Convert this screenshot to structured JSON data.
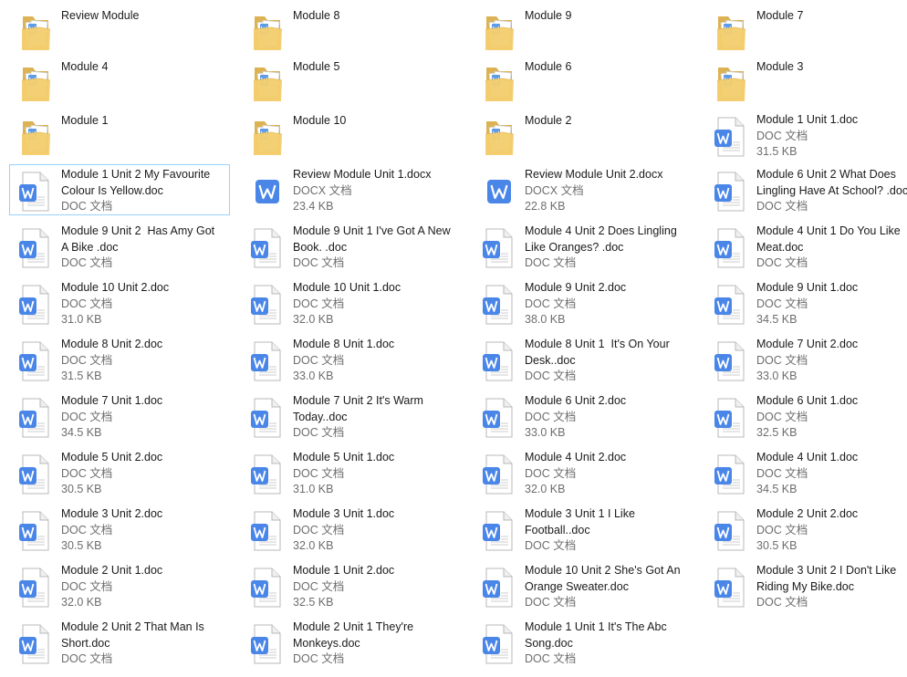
{
  "items": [
    {
      "kind": "folder",
      "name": [
        "Review Module"
      ]
    },
    {
      "kind": "folder",
      "name": [
        "Module 8"
      ]
    },
    {
      "kind": "folder",
      "name": [
        "Module 9"
      ]
    },
    {
      "kind": "folder",
      "name": [
        "Module 7"
      ]
    },
    {
      "kind": "folder",
      "name": [
        "Module 4"
      ]
    },
    {
      "kind": "folder",
      "name": [
        "Module 5"
      ]
    },
    {
      "kind": "folder",
      "name": [
        "Module 6"
      ]
    },
    {
      "kind": "folder",
      "name": [
        "Module 3"
      ]
    },
    {
      "kind": "folder",
      "name": [
        "Module 1"
      ]
    },
    {
      "kind": "folder",
      "name": [
        "Module 10"
      ]
    },
    {
      "kind": "folder",
      "name": [
        "Module 2"
      ]
    },
    {
      "kind": "doc",
      "name": [
        "Module 1 Unit 1.doc"
      ],
      "type": "DOC 文档",
      "size": "31.5 KB"
    },
    {
      "kind": "doc",
      "name": [
        "Module 1 Unit 2 My Favourite",
        "Colour Is Yellow.doc"
      ],
      "type": "DOC 文档",
      "selected": true
    },
    {
      "kind": "docx",
      "name": [
        "Review Module Unit 1.docx"
      ],
      "type": "DOCX 文档",
      "size": "23.4 KB"
    },
    {
      "kind": "docx",
      "name": [
        "Review Module Unit 2.docx"
      ],
      "type": "DOCX 文档",
      "size": "22.8 KB"
    },
    {
      "kind": "doc",
      "name": [
        "Module 6 Unit 2 What Does",
        "Lingling Have At School? .doc"
      ],
      "type": "DOC 文档"
    },
    {
      "kind": "doc",
      "name": [
        "Module 9 Unit 2  Has Amy Got",
        "A Bike .doc"
      ],
      "type": "DOC 文档"
    },
    {
      "kind": "doc",
      "name": [
        "Module 9 Unit 1 I've Got A New",
        "Book. .doc"
      ],
      "type": "DOC 文档"
    },
    {
      "kind": "doc",
      "name": [
        "Module 4 Unit 2 Does Lingling",
        "Like Oranges? .doc"
      ],
      "type": "DOC 文档"
    },
    {
      "kind": "doc",
      "name": [
        "Module 4 Unit 1 Do You Like",
        "Meat.doc"
      ],
      "type": "DOC 文档"
    },
    {
      "kind": "doc",
      "name": [
        "Module 10 Unit 2.doc"
      ],
      "type": "DOC 文档",
      "size": "31.0 KB"
    },
    {
      "kind": "doc",
      "name": [
        "Module 10 Unit 1.doc"
      ],
      "type": "DOC 文档",
      "size": "32.0 KB"
    },
    {
      "kind": "doc",
      "name": [
        "Module 9 Unit 2.doc"
      ],
      "type": "DOC 文档",
      "size": "38.0 KB"
    },
    {
      "kind": "doc",
      "name": [
        "Module 9 Unit 1.doc"
      ],
      "type": "DOC 文档",
      "size": "34.5 KB"
    },
    {
      "kind": "doc",
      "name": [
        "Module 8 Unit 2.doc"
      ],
      "type": "DOC 文档",
      "size": "31.5 KB"
    },
    {
      "kind": "doc",
      "name": [
        "Module 8 Unit 1.doc"
      ],
      "type": "DOC 文档",
      "size": "33.0 KB"
    },
    {
      "kind": "doc",
      "name": [
        "Module 8 Unit 1  It's On Your",
        "Desk..doc"
      ],
      "type": "DOC 文档"
    },
    {
      "kind": "doc",
      "name": [
        "Module 7 Unit 2.doc"
      ],
      "type": "DOC 文档",
      "size": "33.0 KB"
    },
    {
      "kind": "doc",
      "name": [
        "Module 7 Unit 1.doc"
      ],
      "type": "DOC 文档",
      "size": "34.5 KB"
    },
    {
      "kind": "doc",
      "name": [
        "Module 7 Unit 2 It's Warm",
        "Today..doc"
      ],
      "type": "DOC 文档"
    },
    {
      "kind": "doc",
      "name": [
        "Module 6 Unit 2.doc"
      ],
      "type": "DOC 文档",
      "size": "33.0 KB"
    },
    {
      "kind": "doc",
      "name": [
        "Module 6 Unit 1.doc"
      ],
      "type": "DOC 文档",
      "size": "32.5 KB"
    },
    {
      "kind": "doc",
      "name": [
        "Module 5 Unit 2.doc"
      ],
      "type": "DOC 文档",
      "size": "30.5 KB"
    },
    {
      "kind": "doc",
      "name": [
        "Module 5 Unit 1.doc"
      ],
      "type": "DOC 文档",
      "size": "31.0 KB"
    },
    {
      "kind": "doc",
      "name": [
        "Module 4 Unit 2.doc"
      ],
      "type": "DOC 文档",
      "size": "32.0 KB"
    },
    {
      "kind": "doc",
      "name": [
        "Module 4 Unit 1.doc"
      ],
      "type": "DOC 文档",
      "size": "34.5 KB"
    },
    {
      "kind": "doc",
      "name": [
        "Module 3 Unit 2.doc"
      ],
      "type": "DOC 文档",
      "size": "30.5 KB"
    },
    {
      "kind": "doc",
      "name": [
        "Module 3 Unit 1.doc"
      ],
      "type": "DOC 文档",
      "size": "32.0 KB"
    },
    {
      "kind": "doc",
      "name": [
        "Module 3 Unit 1 I Like",
        "Football..doc"
      ],
      "type": "DOC 文档"
    },
    {
      "kind": "doc",
      "name": [
        "Module 2 Unit 2.doc"
      ],
      "type": "DOC 文档",
      "size": "30.5 KB"
    },
    {
      "kind": "doc",
      "name": [
        "Module 2 Unit 1.doc"
      ],
      "type": "DOC 文档",
      "size": "32.0 KB"
    },
    {
      "kind": "doc",
      "name": [
        "Module 1 Unit 2.doc"
      ],
      "type": "DOC 文档",
      "size": "32.5 KB"
    },
    {
      "kind": "doc",
      "name": [
        "Module 10 Unit 2 She's Got An",
        "Orange Sweater.doc"
      ],
      "type": "DOC 文档"
    },
    {
      "kind": "doc",
      "name": [
        "Module 3 Unit 2 I Don't Like",
        "Riding My Bike.doc"
      ],
      "type": "DOC 文档"
    },
    {
      "kind": "doc",
      "name": [
        "Module 2 Unit 2 That Man Is",
        "Short.doc"
      ],
      "type": "DOC 文档"
    },
    {
      "kind": "doc",
      "name": [
        "Module 2 Unit 1 They're",
        "Monkeys.doc"
      ],
      "type": "DOC 文档"
    },
    {
      "kind": "doc",
      "name": [
        "Module 1 Unit 1 It's The Abc",
        "Song.doc"
      ],
      "type": "DOC 文档"
    }
  ]
}
